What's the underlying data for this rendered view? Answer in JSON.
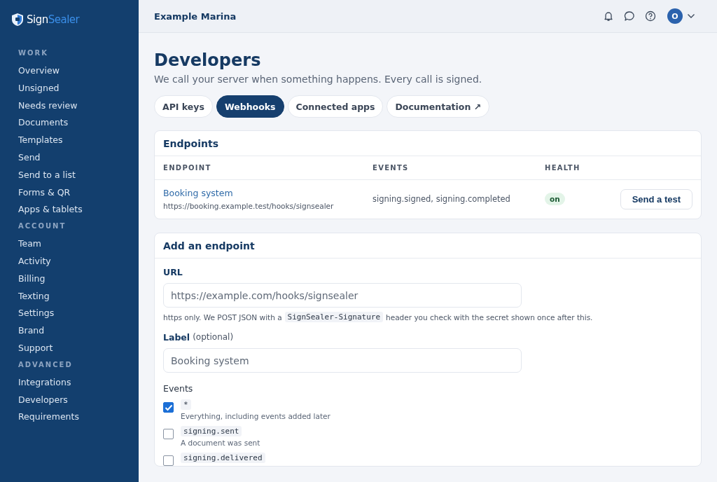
{
  "brand": {
    "first": "Sign",
    "second": "Sealer"
  },
  "sidebar": {
    "sections": [
      {
        "heading": "WORK",
        "items": [
          "Overview",
          "Unsigned",
          "Needs review",
          "Documents",
          "Templates",
          "Send",
          "Send to a list",
          "Forms & QR",
          "Apps & tablets"
        ]
      },
      {
        "heading": "ACCOUNT",
        "items": [
          "Team",
          "Activity",
          "Billing",
          "Texting",
          "Settings",
          "Brand",
          "Support"
        ]
      },
      {
        "heading": "ADVANCED",
        "items": [
          "Integrations",
          "Developers",
          "Requirements"
        ]
      }
    ]
  },
  "header": {
    "org": "Example Marina",
    "avatar": "O"
  },
  "page": {
    "title": "Developers",
    "subtitle": "We call your server when something happens. Every call is signed."
  },
  "tabs": [
    {
      "label": "API keys",
      "selected": false
    },
    {
      "label": "Webhooks",
      "selected": true
    },
    {
      "label": "Connected apps",
      "selected": false
    },
    {
      "label": "Documentation ↗",
      "selected": false
    }
  ],
  "endpoints": {
    "title": "Endpoints",
    "columns": [
      "ENDPOINT",
      "EVENTS",
      "HEALTH"
    ],
    "rows": [
      {
        "name": "Booking system",
        "url": "https://booking.example.test/hooks/signsealer",
        "events": "signing.signed, signing.completed",
        "health": "on",
        "action": "Send a test"
      }
    ]
  },
  "add": {
    "title": "Add an endpoint",
    "url": {
      "label": "URL",
      "placeholder": "https://example.com/hooks/signsealer",
      "help_before": "https only. We POST JSON with a",
      "help_code": "SignSealer-Signature",
      "help_after": "header you check with the secret shown once after this."
    },
    "label": {
      "label": "Label",
      "hint": "(optional)",
      "placeholder": "Booking system"
    },
    "events_label": "Events",
    "events": [
      {
        "code": "*",
        "description": "Everything, including events added later",
        "checked": true
      },
      {
        "code": "signing.sent",
        "description": "A document was sent",
        "checked": false
      },
      {
        "code": "signing.delivered",
        "checked": false
      }
    ]
  }
}
